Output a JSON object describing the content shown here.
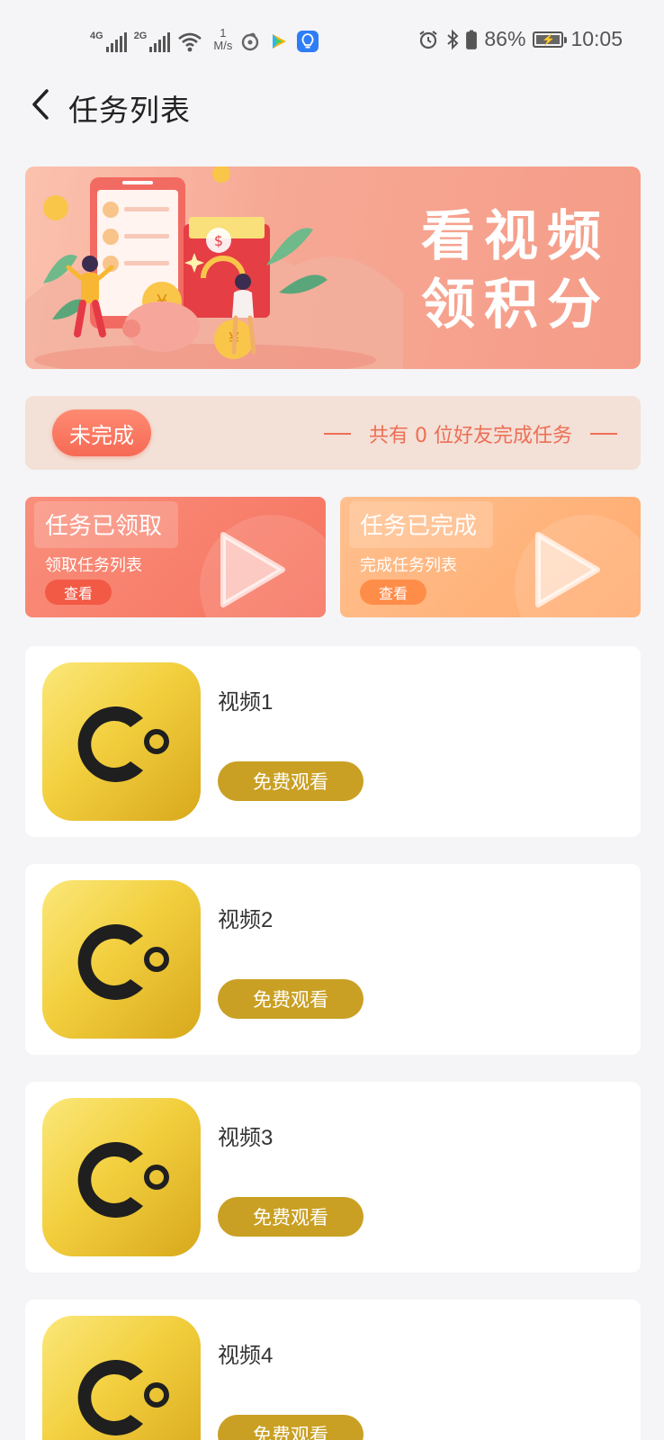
{
  "status_bar": {
    "signal1_tag": "4G",
    "signal2_tag": "2G",
    "net_speed_value": "1",
    "net_speed_unit": "M/s",
    "battery_percent": "86%",
    "time": "10:05"
  },
  "header": {
    "title": "任务列表"
  },
  "banner": {
    "text_line1": "看视频",
    "text_line2": "领积分"
  },
  "progress": {
    "status_label": "未完成",
    "friends_text": "共有 0 位好友完成任务"
  },
  "task_cards": [
    {
      "title": "任务已领取",
      "subtitle": "领取任务列表",
      "button": "查看"
    },
    {
      "title": "任务已完成",
      "subtitle": "完成任务列表",
      "button": "查看"
    }
  ],
  "videos": [
    {
      "title": "视频1",
      "button": "免费观看"
    },
    {
      "title": "视频2",
      "button": "免费观看"
    },
    {
      "title": "视频3",
      "button": "免费观看"
    },
    {
      "title": "视频4",
      "button": "免费观看"
    }
  ],
  "colors": {
    "accent_gold": "#c9a023",
    "accent_coral": "#f6735f",
    "accent_orange": "#ffaa6e",
    "text_friends": "#ee6e55"
  }
}
